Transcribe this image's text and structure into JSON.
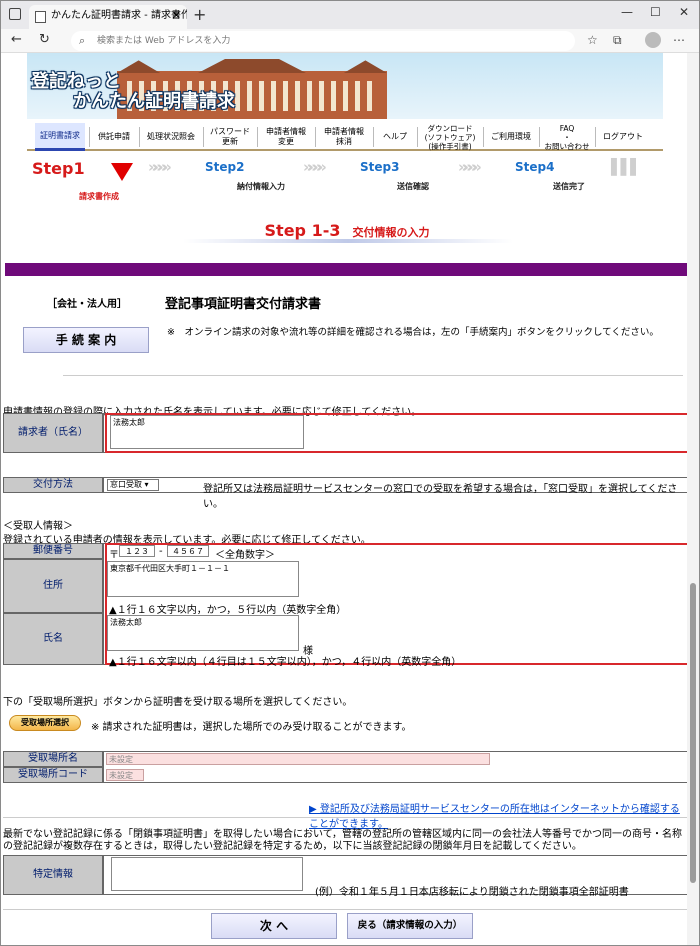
{
  "browser": {
    "tab_title": "かんたん証明書請求 - 請求書作成",
    "tab_close": "✕",
    "new_tab": "+",
    "address_placeholder": "検索または Web アドレスを入力",
    "window_controls": [
      "—",
      "☐",
      "✕"
    ]
  },
  "banner": {
    "line1": "登記ねっと",
    "line2": "かんたん証明書請求"
  },
  "menu": [
    {
      "label": "証明書請求",
      "selected": true
    },
    {
      "label": "供託申請"
    },
    {
      "label": "処理状況照会"
    },
    {
      "label": "パスワード\n更新"
    },
    {
      "label": "申請者情報\n変更"
    },
    {
      "label": "申請者情報\n抹消"
    },
    {
      "label": "ヘルプ"
    },
    {
      "label": "ダウンロード\n(ソフトウェア)\n(操作手引書)"
    },
    {
      "label": "ご利用環境"
    },
    {
      "label": "FAQ\n・\nお問い合わせ"
    },
    {
      "label": "ログアウト"
    }
  ],
  "steps": {
    "step1": "Step1",
    "step1_sub": "請求書作成",
    "step2": "Step2",
    "step2_sub": "納付情報入力",
    "step3": "Step3",
    "step3_sub": "送信確認",
    "step4": "Step4",
    "step4_sub": "送信完了",
    "current": "Step 1-3",
    "current_title": "交付情報の入力"
  },
  "form": {
    "company_tag": "［会社・法人用］",
    "form_title": "登記事項証明書交付請求書",
    "guide_button": "手 続 案 内",
    "guide_note": "※　オンライン請求の対象や流れ等の詳細を確認される場合は，左の「手続案内」ボタンをクリックしてください。",
    "applicant_note": "申請書情報の登録の際に入力された氏名を表示しています。必要に応じて修正してください。",
    "applicant_label": "請求者（氏名）",
    "applicant_value": "法務太郎",
    "delivery_label": "交付方法",
    "delivery_value": "窓口受取",
    "delivery_note": "登記所又は法務局証明サービスセンターの窓口での受取を希望する場合は，「窓口受取」を選択してください。",
    "recipient_header": "＜受取人情報＞",
    "recipient_note": "登録されている申請者の情報を表示しています。必要に応じて修正してください。",
    "postal_label": "郵便番号",
    "postal_mark": "〒",
    "postal1": "１２３",
    "postal_dash": "-",
    "postal2": "４５６７",
    "postal_hint": "＜全角数字＞",
    "address_label": "住所",
    "address_value": "東京都千代田区大手町１－１－１",
    "address_hint": "▲１行１６文字以内，かつ，５行以内（英数字全角）",
    "name_label": "氏名",
    "name_value": "法務太郎",
    "name_suffix": "様",
    "name_hint": "▲１行１６文字以内（４行目は１５文字以内），かつ，４行以内（英数字全角）",
    "pickup_note": "下の「受取場所選択」ボタンから証明書を受け取る場所を選択してください。",
    "pickup_button": "受取場所選択",
    "pickup_button_note": "※ 請求された証明書は，選択した場所でのみ受け取ることができます。",
    "pickup_name_label": "受取場所名",
    "pickup_name_value": "未設定",
    "pickup_code_label": "受取場所コード",
    "pickup_code_value": "未設定",
    "location_link": "▶ 登記所及び法務局証明サービスセンターの所在地はインターネットから確認することができます。",
    "closed_note": "最新でない登記記録に係る「閉鎖事項証明書」を取得したい場合において，管轄の登記所の管轄区域内に同一の会社法人等番号でかつ同一の商号・名称の登記記録が複数存在するときは，取得したい登記記録を特定するため，以下に当該登記記録の閉鎖年月日を記載してください。",
    "specific_label": "特定情報",
    "specific_example": "(例）令和１年５月１日本店移転により閉鎖された閉鎖事項全部証明書",
    "next_button": "次 へ",
    "back_button": "戻る（請求情報の入力）"
  }
}
